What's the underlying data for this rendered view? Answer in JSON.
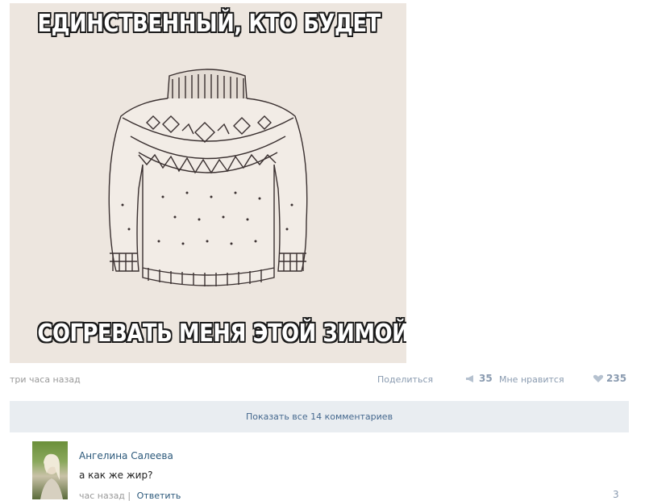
{
  "post": {
    "image": {
      "caption_top": "ЕДИНСТВЕННЫЙ, КТО БУДЕТ",
      "caption_bottom": "СОГРЕВАТЬ МЕНЯ ЭТОЙ ЗИМОЙ",
      "subject": "sweater"
    },
    "time": "три часа назад",
    "share_label": "Поделиться",
    "share_count": "35",
    "like_label": "Мне нравится",
    "like_count": "235"
  },
  "comments": {
    "show_all_label": "Показать все 14 комментариев",
    "items": [
      {
        "author": "Ангелина Салеева",
        "text": "а как же жир?",
        "time": "час назад",
        "separator": "|",
        "reply_label": "Ответить",
        "likes": "3"
      }
    ]
  },
  "colors": {
    "link": "#2b587a",
    "muted": "#999999",
    "bar_bg": "#e9edf1",
    "meme_bg": "#ede6df"
  }
}
